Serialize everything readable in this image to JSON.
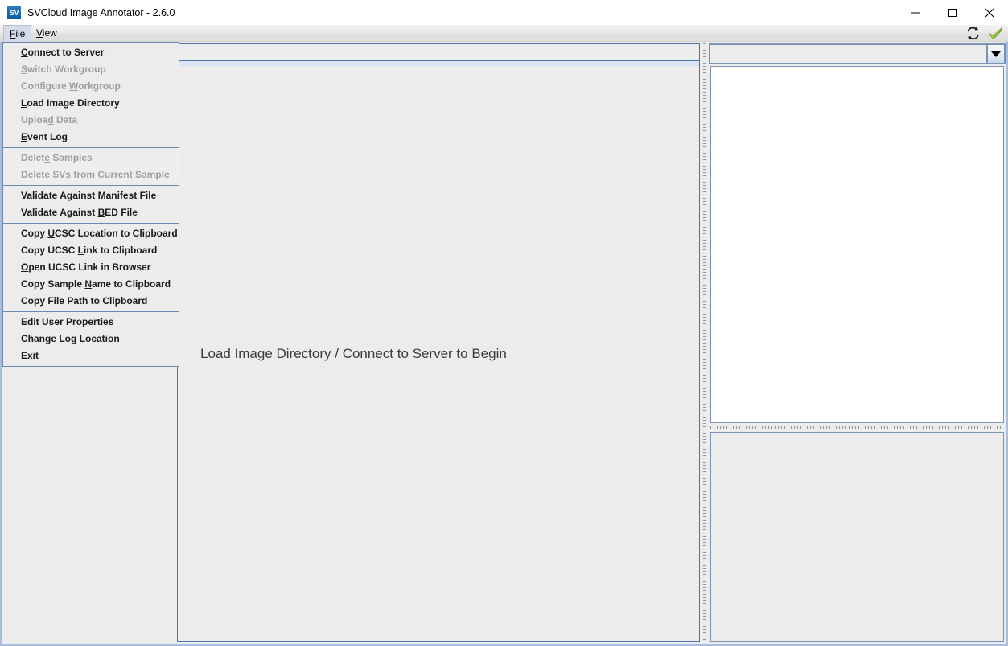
{
  "window": {
    "title": "SVCloud Image Annotator - 2.6.0",
    "icon_label": "SV",
    "icon_name": "app-icon-sv",
    "controls": {
      "minimize": "minimize-icon",
      "maximize": "maximize-icon",
      "close": "close-icon"
    }
  },
  "menubar": {
    "items": [
      {
        "label": "File",
        "mnemonic": "F",
        "active": true
      },
      {
        "label": "View",
        "mnemonic": "V",
        "active": false
      }
    ],
    "icons": [
      {
        "name": "refresh-sync-icon",
        "color": "#1a1a1a"
      },
      {
        "name": "green-check-icon",
        "color": "#8cc63f"
      }
    ]
  },
  "file_menu": {
    "open": true,
    "groups": [
      {
        "items": [
          {
            "label": "Connect to Server",
            "mnemonic_index": 0,
            "enabled": true
          },
          {
            "label": "Switch Workgroup",
            "mnemonic_index": 0,
            "enabled": false
          },
          {
            "label": "Configure Workgroup",
            "mnemonic_index": 10,
            "enabled": false
          },
          {
            "label": "Load Image Directory",
            "mnemonic_index": 0,
            "enabled": true
          },
          {
            "label": "Upload Data",
            "mnemonic_index": 5,
            "enabled": false
          },
          {
            "label": "Event Log",
            "mnemonic_index": 0,
            "enabled": true
          }
        ]
      },
      {
        "items": [
          {
            "label": "Delete Samples",
            "mnemonic_index": 5,
            "enabled": false
          },
          {
            "label": "Delete SVs from Current Sample",
            "mnemonic_index": 8,
            "enabled": false
          }
        ]
      },
      {
        "items": [
          {
            "label": "Validate Against Manifest File",
            "mnemonic_index": 17,
            "enabled": true
          },
          {
            "label": "Validate Against BED File",
            "mnemonic_index": 17,
            "enabled": true
          }
        ]
      },
      {
        "items": [
          {
            "label": "Copy UCSC Location to Clipboard",
            "mnemonic_index": 5,
            "enabled": true
          },
          {
            "label": "Copy UCSC Link to Clipboard",
            "mnemonic_index": 10,
            "enabled": true
          },
          {
            "label": "Open UCSC Link in Browser",
            "mnemonic_index": 0,
            "enabled": true
          },
          {
            "label": "Copy Sample Name to Clipboard",
            "mnemonic_index": 12,
            "enabled": true
          },
          {
            "label": "Copy File Path to Clipboard",
            "mnemonic_index": -1,
            "enabled": true
          }
        ]
      },
      {
        "items": [
          {
            "label": "Edit User Properties",
            "mnemonic_index": -1,
            "enabled": true
          },
          {
            "label": "Change Log Location",
            "mnemonic_index": -1,
            "enabled": true
          },
          {
            "label": "Exit",
            "mnemonic_index": -1,
            "enabled": true
          }
        ]
      }
    ]
  },
  "center": {
    "message": "Load Image Directory / Connect to Server to Begin"
  },
  "right": {
    "combo": {
      "value": "",
      "placeholder": ""
    },
    "list_items": [],
    "detail_text": ""
  },
  "colors": {
    "window_border": "#a8bde0",
    "panel_border": "#4f73ad",
    "menu_border": "#7087b0",
    "panel_bg": "#ececec",
    "accent_strip": "#dbe4f4",
    "check_green": "#8cc63f"
  }
}
